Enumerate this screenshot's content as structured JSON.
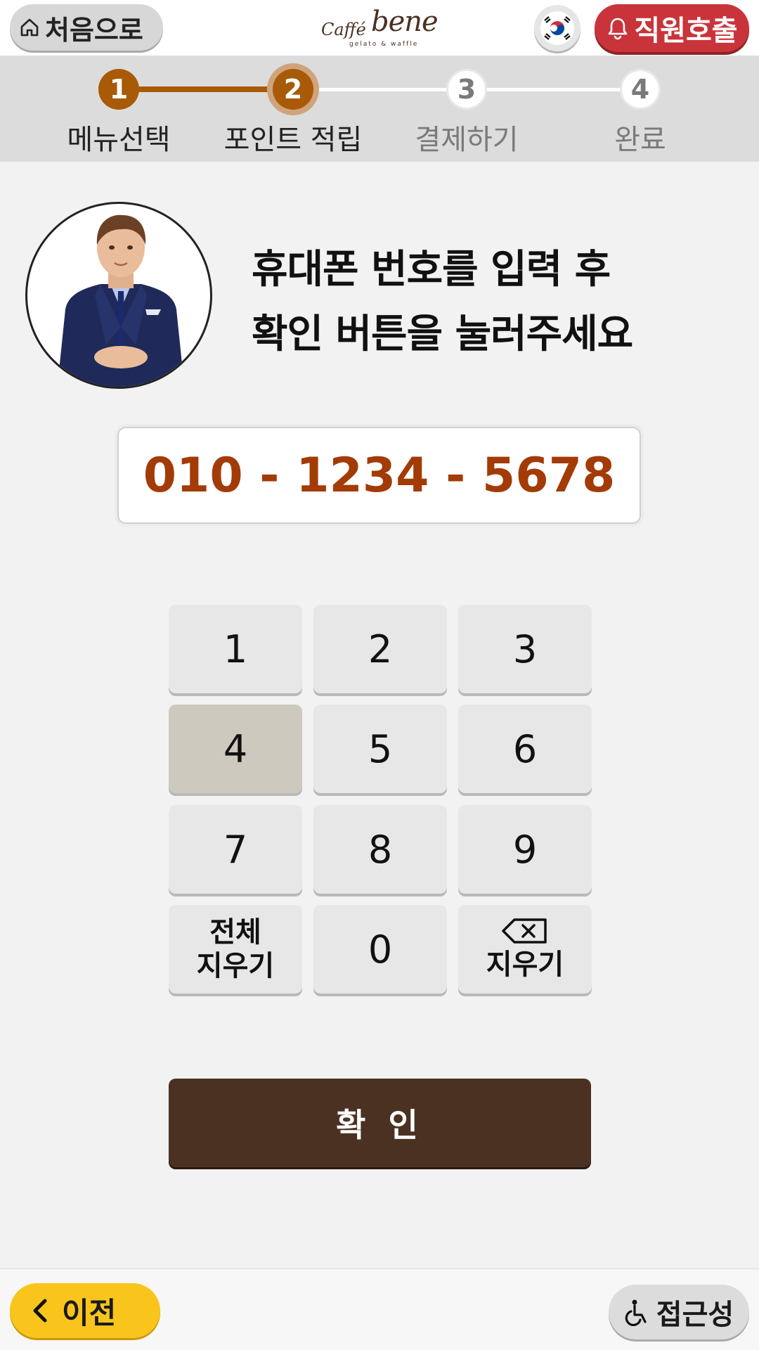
{
  "header": {
    "home_label": "처음으로",
    "logo": {
      "brand_small": "Caffé",
      "brand_large": "bene",
      "tagline": "gelato & waffle"
    },
    "language_icon": "korea-flag-icon",
    "call_staff_label": "직원호출"
  },
  "steps": [
    {
      "number": "1",
      "label": "메뉴선택",
      "state": "done"
    },
    {
      "number": "2",
      "label": "포인트 적립",
      "state": "current"
    },
    {
      "number": "3",
      "label": "결제하기",
      "state": "todo"
    },
    {
      "number": "4",
      "label": "완료",
      "state": "todo"
    }
  ],
  "prompt": {
    "line1": "휴대폰 번호를 입력 후",
    "line2": "확인 버튼을 눌러주세요"
  },
  "phone_display": "010 - 1234 - 5678",
  "keypad": {
    "keys": [
      "1",
      "2",
      "3",
      "4",
      "5",
      "6",
      "7",
      "8",
      "9"
    ],
    "clear_all_line1": "전체",
    "clear_all_line2": "지우기",
    "zero": "0",
    "backspace_label": "지우기",
    "active_key": "4"
  },
  "confirm_label": "확 인",
  "footer": {
    "prev_label": "이전",
    "accessibility_label": "접근성"
  },
  "colors": {
    "accent_brown": "#4a3122",
    "step_done": "#a85a06",
    "phone_text": "#a33b07",
    "call_red": "#c9343a",
    "prev_yellow": "#f9c51c"
  }
}
